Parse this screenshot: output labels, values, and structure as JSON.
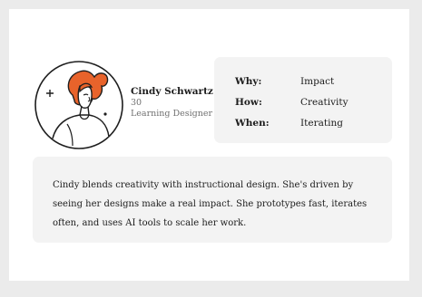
{
  "persona": {
    "name": "Cindy Schwartz",
    "age": "30",
    "role": "Learning Designer",
    "avatar_icon": "woman-portrait-icon",
    "accent_color": "#e8632b"
  },
  "facts": [
    {
      "label": "Why:",
      "value": "Impact"
    },
    {
      "label": "How:",
      "value": "Creativity"
    },
    {
      "label": "When:",
      "value": "Iterating"
    }
  ],
  "bio": "Cindy blends creativity with instructional design. She's driven by seeing her designs make a real impact. She prototypes fast, iterates often, and uses AI tools to scale her work."
}
